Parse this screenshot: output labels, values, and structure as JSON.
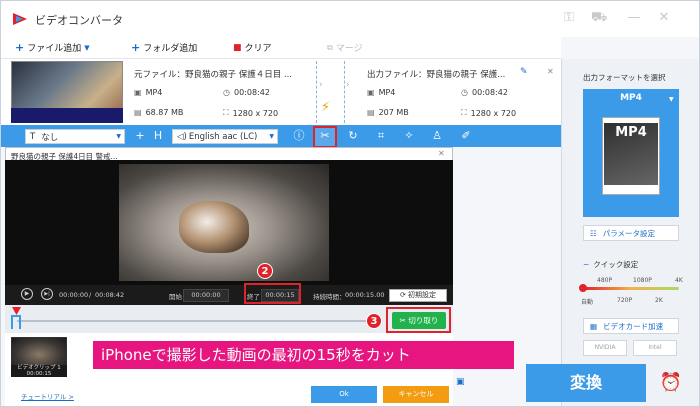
{
  "app": {
    "title": "ビデオコンバータ"
  },
  "toolbar": {
    "add_file": "ファイル追加",
    "add_folder": "フォルダ追加",
    "clear": "クリア",
    "merge": "マージ"
  },
  "source": {
    "label": "元ファイル：野良猫の親子 保護４日目 ...",
    "format": "MP4",
    "duration": "00:08:42",
    "size": "68.87 MB",
    "resolution": "1280 x 720"
  },
  "output": {
    "label": "出力ファイル：野良猫の親子 保護...",
    "format": "MP4",
    "duration": "00:08:42",
    "size": "207 MB",
    "resolution": "1280 x 720"
  },
  "editbar": {
    "subtitle": "なし",
    "audio_track": "English aac (LC)"
  },
  "trim_dialog": {
    "title": "野良猫の親子 保護4日目 警戒...",
    "current_time": "00:00:00",
    "total_time": "00:08:42",
    "time_sep": "/",
    "start_label": "開始",
    "start_value": "00:00:00",
    "end_label": "終了",
    "end_value": "00:00:15",
    "duration_label": "持続時間：",
    "duration_value": "00:00:15.00",
    "reset_label": "初期設定",
    "cut_label": "切り取り",
    "clip_name": "ビデオクリップ 1",
    "clip_time": "00:00:15",
    "tutorial_link": "チュートリアル >",
    "ok_label": "Ok",
    "cancel_label": "キャンセル"
  },
  "annotation": {
    "banner_text": "iPhoneで撮影した動画の最初の15秒をカット",
    "badges": [
      "1",
      "2",
      "3"
    ]
  },
  "right_panel": {
    "select_format_label": "出力フォーマットを選択",
    "format": "MP4",
    "param_label": "パラメータ設定",
    "quick_label": "クイック設定",
    "quality_top": [
      "480P",
      "1080P",
      "4K"
    ],
    "quality_bottom": [
      "自動",
      "720P",
      "2K"
    ],
    "gpu_label": "ビデオカード加速",
    "gpu_vendors": [
      "NVIDIA",
      "Intel"
    ],
    "convert_label": "変換"
  },
  "colors": {
    "accent": "#3c9be8",
    "highlight": "#e0222a",
    "banner": "#e6157f",
    "cut_button": "#22b24c",
    "cancel": "#f39c12"
  }
}
